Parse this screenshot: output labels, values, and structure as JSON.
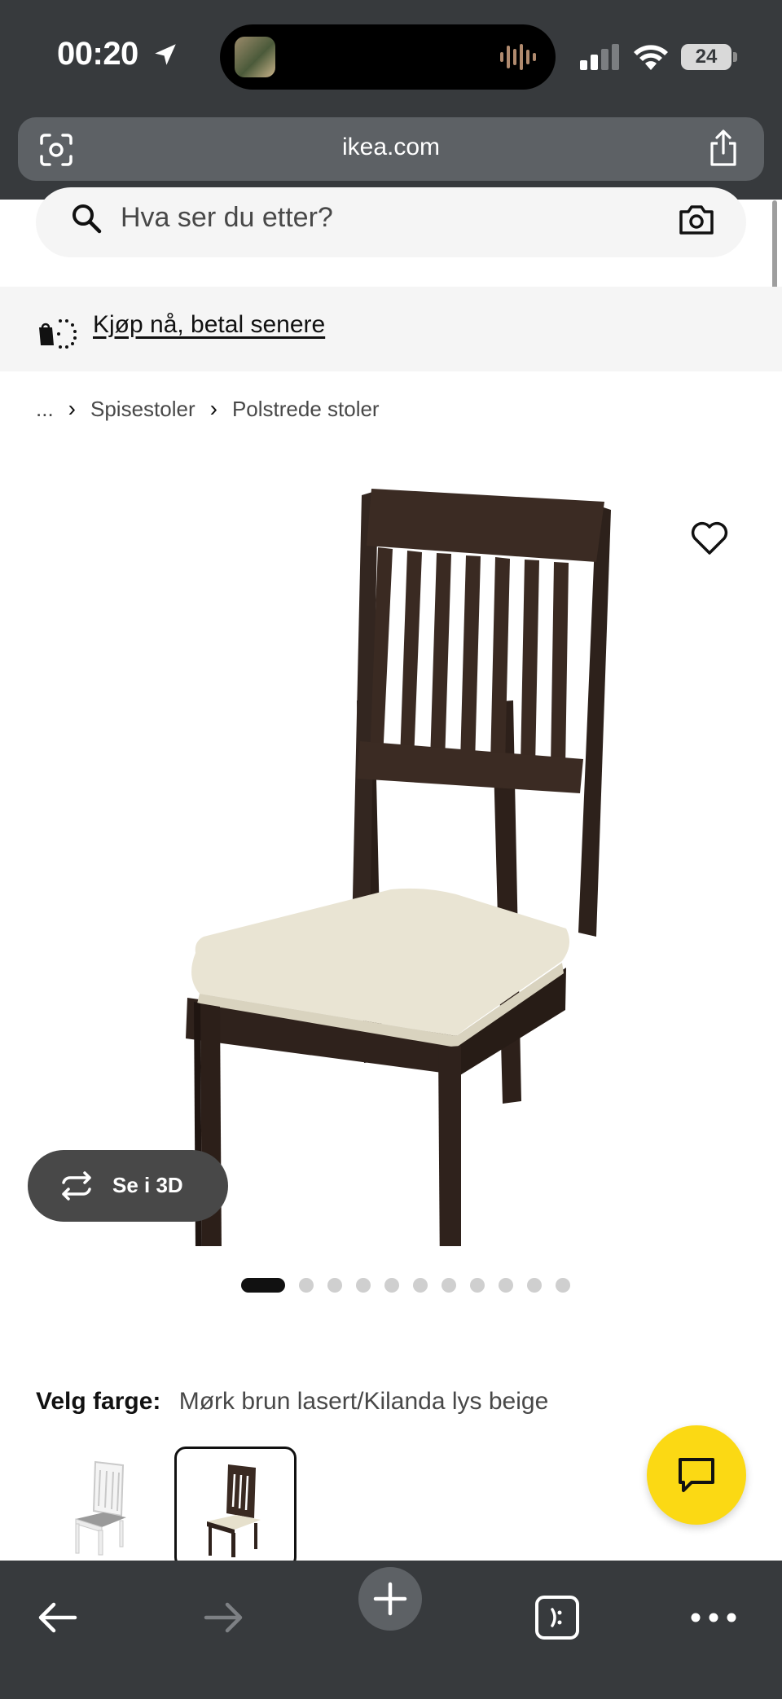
{
  "status_bar": {
    "time": "00:20",
    "battery": "24"
  },
  "browser": {
    "url": "ikea.com"
  },
  "search": {
    "placeholder": "Hva ser du etter?"
  },
  "promo": {
    "text": "Kjøp nå, betal senere"
  },
  "breadcrumb": {
    "items": [
      "...",
      "Spisestoler",
      "Polstrede stoler"
    ]
  },
  "gallery": {
    "view_3d_label": "Se i 3D",
    "image_count": 11,
    "active_index": 0
  },
  "color_picker": {
    "label": "Velg farge:",
    "selected_value": "Mørk brun lasert/Kilanda lys beige",
    "options": [
      {
        "name": "white",
        "selected": false
      },
      {
        "name": "dark-brown",
        "selected": true
      }
    ]
  },
  "colors": {
    "chat_button": "#fbd914",
    "toolbar_bg": "#373a3d",
    "chair_wood": "#3a2a22",
    "chair_seat": "#e9e4d3"
  },
  "icons": {
    "status": [
      "location-arrow-icon",
      "signal-icon",
      "wifi-icon",
      "battery-icon"
    ],
    "address_bar": [
      "visual-search-icon",
      "share-icon"
    ],
    "page": [
      "search-icon",
      "camera-icon",
      "pay-later-icon",
      "heart-icon",
      "rotate-3d-icon",
      "chat-icon"
    ],
    "toolbar": [
      "back-arrow-icon",
      "forward-arrow-icon",
      "new-tab-plus-icon",
      "tabs-icon",
      "more-icon"
    ]
  }
}
